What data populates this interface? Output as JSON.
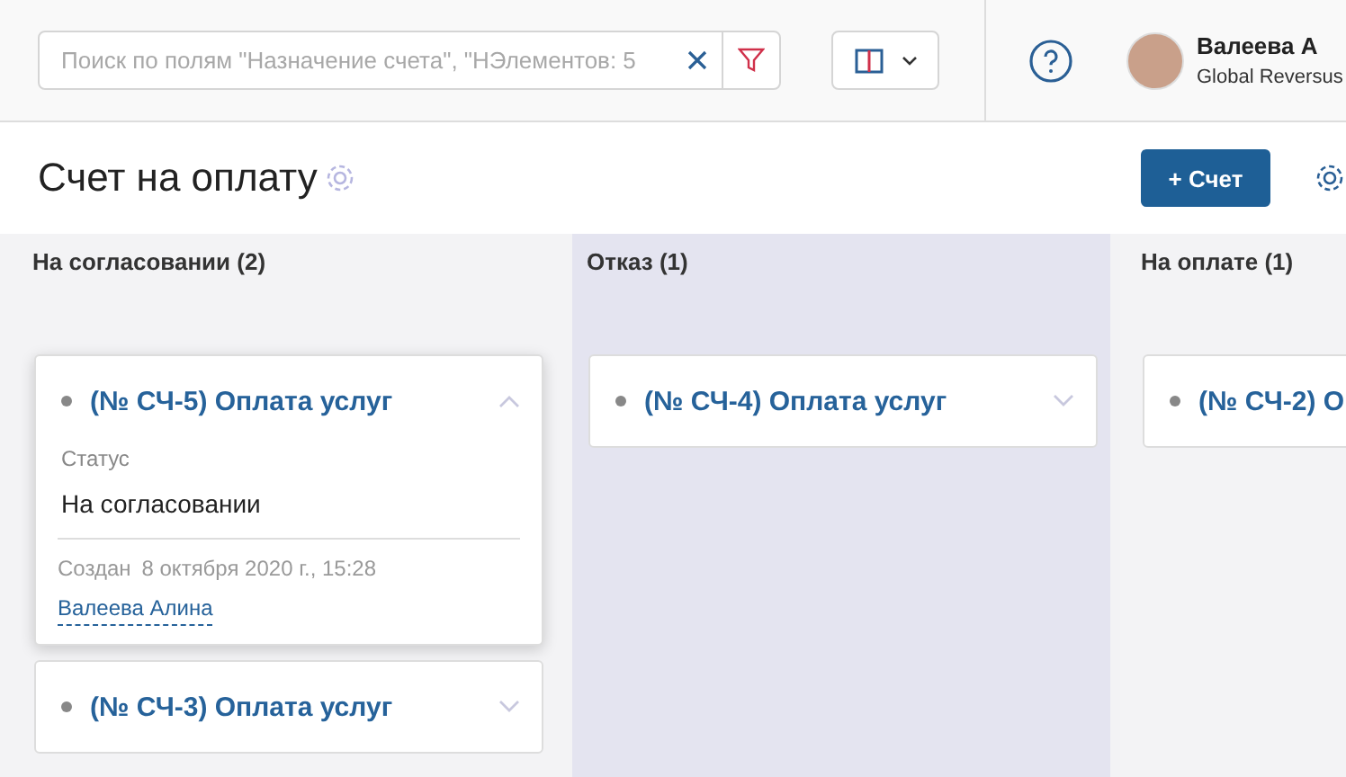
{
  "search": {
    "placeholder": "Поиск по полям \"Назначение счета\", \"НЭлементов: 5"
  },
  "user": {
    "name": "Валеева А",
    "company": "Global Reversus"
  },
  "page": {
    "title": "Счет на оплату",
    "add_button": "+ Счет"
  },
  "columns": [
    {
      "title": "На согласовании (2)",
      "highlighted": false,
      "cards": [
        {
          "title": "(№ СЧ-5) Оплата услуг",
          "expanded": true,
          "status_label": "Статус",
          "status": "На согласовании",
          "created_label": "Создан",
          "created": "8 октября 2020 г., 15:28",
          "author": "Валеева Алина"
        },
        {
          "title": "(№ СЧ-3) Оплата услуг",
          "expanded": false
        }
      ]
    },
    {
      "title": "Отказ (1)",
      "highlighted": true,
      "cards": [
        {
          "title": "(№ СЧ-4) Оплата услуг",
          "expanded": false
        }
      ]
    },
    {
      "title": "На оплате (1)",
      "highlighted": false,
      "cards": [
        {
          "title": "(№ СЧ-2) О",
          "expanded": false
        }
      ]
    }
  ]
}
